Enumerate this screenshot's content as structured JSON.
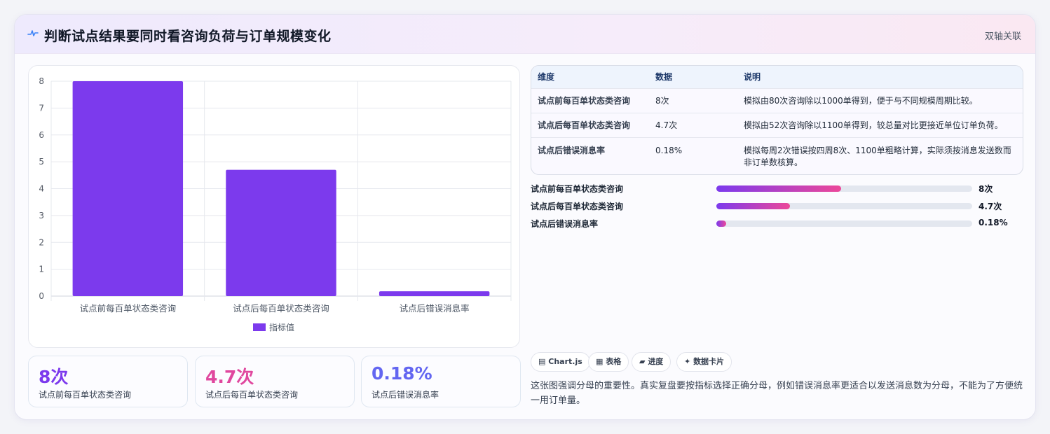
{
  "header": {
    "title": "判断试点结果要同时看咨询负荷与订单规模变化",
    "tag": "双轴关联",
    "icon": "pulse-icon"
  },
  "chart_data": {
    "type": "bar",
    "categories": [
      "试点前每百单状态类咨询",
      "试点后每百单状态类咨询",
      "试点后错误消息率"
    ],
    "series": [
      {
        "name": "指标值",
        "values": [
          8,
          4.7,
          0.18
        ],
        "color": "#7c3aed"
      }
    ],
    "ylim": [
      0,
      8
    ],
    "yticks": [
      0,
      1,
      2,
      3,
      4,
      5,
      6,
      7,
      8
    ],
    "grid": true,
    "legend": "bottom"
  },
  "stats": [
    {
      "value": "8次",
      "label": "试点前每百单状态类咨询",
      "color": "#7c3aed"
    },
    {
      "value": "4.7次",
      "label": "试点后每百单状态类咨询",
      "color": "#e0479e"
    },
    {
      "value": "0.18%",
      "label": "试点后错误消息率",
      "color": "#6366f1"
    }
  ],
  "table": {
    "headers": [
      "维度",
      "数据",
      "说明"
    ],
    "rows": [
      [
        "试点前每百单状态类咨询",
        "8次",
        "模拟由80次咨询除以1000单得到，便于与不同规模周期比较。"
      ],
      [
        "试点后每百单状态类咨询",
        "4.7次",
        "模拟由52次咨询除以1100单得到，较总量对比更接近单位订单负荷。"
      ],
      [
        "试点后错误消息率",
        "0.18%",
        "模拟每周2次错误按四周8次、1100单粗略计算，实际须按消息发送数而非订单数核算。"
      ]
    ]
  },
  "progress": [
    {
      "label": "试点前每百单状态类咨询",
      "value": "8次",
      "fraction": 0.4877
    },
    {
      "label": "试点后每百单状态类咨询",
      "value": "4.7次",
      "fraction": 0.2877
    },
    {
      "label": "试点后错误消息率",
      "value": "0.18%",
      "fraction": 0.0384
    }
  ],
  "chips": [
    {
      "icon": "chart-icon",
      "glyph": "▤",
      "label": "Chart.js"
    },
    {
      "icon": "table-icon",
      "glyph": "▦",
      "label": "表格"
    },
    {
      "icon": "progress-icon",
      "glyph": "▰",
      "label": "进度"
    },
    {
      "icon": "sparkle-icon",
      "glyph": "✦",
      "label": "数据卡片"
    }
  ],
  "note": "这张图强调分母的重要性。真实复盘要按指标选择正确分母，例如错误消息率更适合以发送消息数为分母，不能为了方便统一用订单量。"
}
